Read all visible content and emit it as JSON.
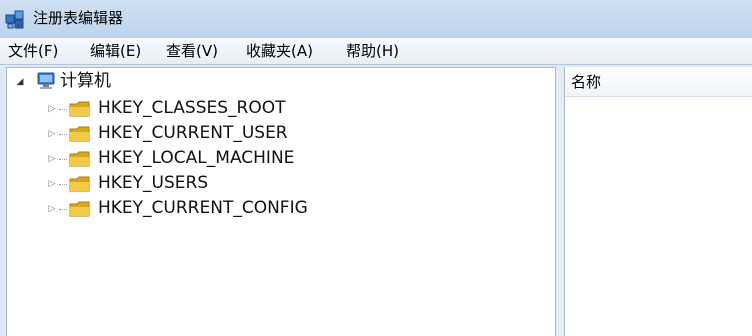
{
  "window": {
    "title": "注册表编辑器"
  },
  "menu": [
    {
      "label": "文件(F)"
    },
    {
      "label": "编辑(E)"
    },
    {
      "label": "查看(V)"
    },
    {
      "label": "收藏夹(A)"
    },
    {
      "label": "帮助(H)"
    }
  ],
  "tree": {
    "root": {
      "label": "计算机",
      "icon": "computer-icon",
      "expanded": true
    },
    "children": [
      {
        "label": "HKEY_CLASSES_ROOT",
        "icon": "folder-icon"
      },
      {
        "label": "HKEY_CURRENT_USER",
        "icon": "folder-icon"
      },
      {
        "label": "HKEY_LOCAL_MACHINE",
        "icon": "folder-icon"
      },
      {
        "label": "HKEY_USERS",
        "icon": "folder-icon"
      },
      {
        "label": "HKEY_CURRENT_CONFIG",
        "icon": "folder-icon"
      }
    ]
  },
  "values": {
    "column_name": "名称"
  },
  "colors": {
    "folder": "#e8b830",
    "window_frame": "#c4d7ee"
  }
}
